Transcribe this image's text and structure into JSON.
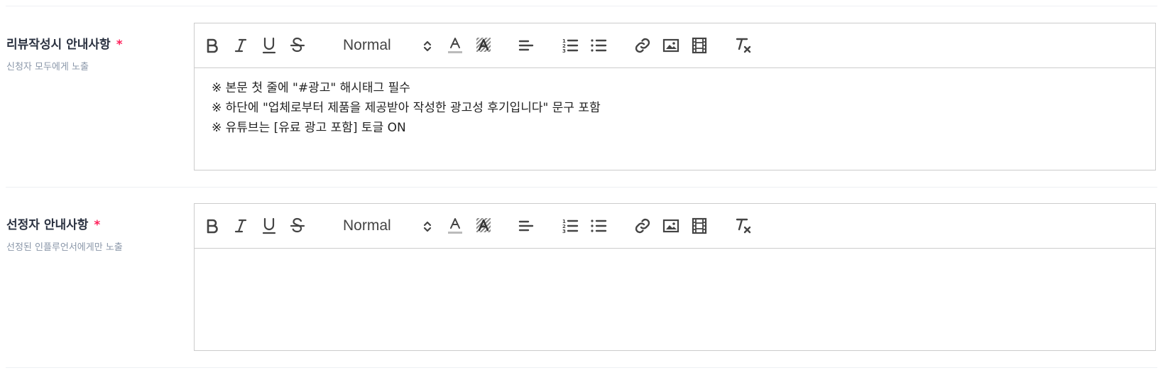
{
  "sections": [
    {
      "label": "리뷰작성시 안내사항",
      "required_mark": "*",
      "sublabel": "신청자 모두에게 노출",
      "editor": {
        "format_value": "Normal",
        "lines": [
          "※ 본문 첫 줄에 \"#광고\" 해시태그 필수",
          "※ 하단에 \"업체로부터 제품을 제공받아 작성한 광고성 후기입니다\" 문구 포함",
          "※ 유튜브는 [유료 광고 포함] 토글 ON"
        ]
      }
    },
    {
      "label": "선정자 안내사항",
      "required_mark": "*",
      "sublabel": "선정된 인플루언서에게만 노출",
      "editor": {
        "format_value": "Normal",
        "lines": []
      }
    }
  ],
  "toolbar_icons": [
    "bold-icon",
    "italic-icon",
    "underline-icon",
    "strike-icon",
    "text-color-icon",
    "background-color-icon",
    "align-icon",
    "ordered-list-icon",
    "bullet-list-icon",
    "link-icon",
    "image-icon",
    "video-icon",
    "clear-format-icon"
  ],
  "colors": {
    "required": "#ff1f5a",
    "label": "#2a3140",
    "sublabel": "#8a97a9",
    "border": "#cccccc"
  }
}
